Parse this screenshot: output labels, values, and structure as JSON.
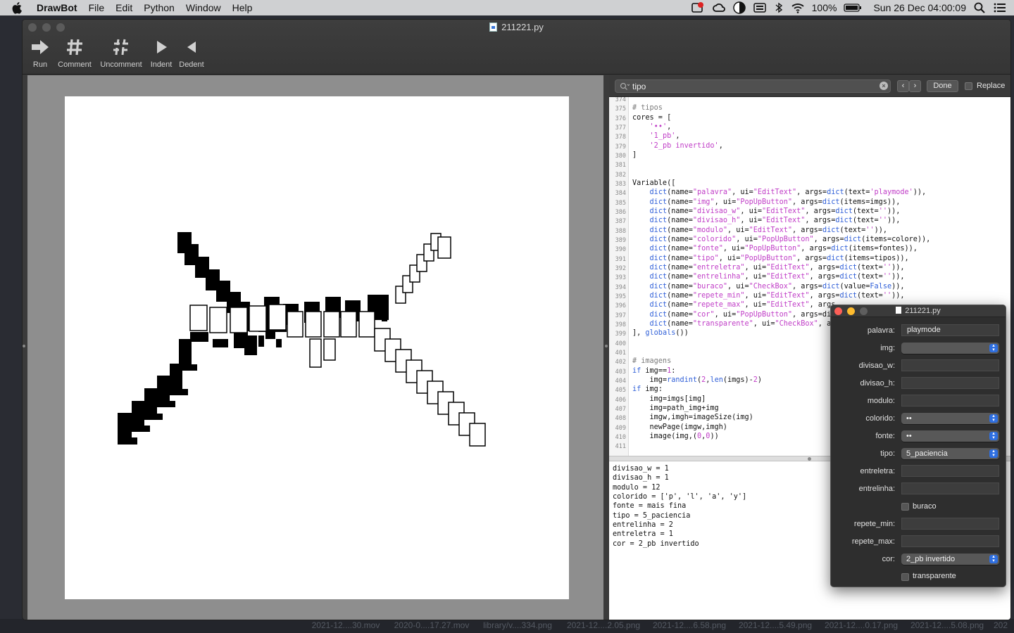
{
  "menubar": {
    "app_name": "DrawBot",
    "items": [
      "File",
      "Edit",
      "Python",
      "Window",
      "Help"
    ],
    "battery": "100%",
    "clock": "Sun 26 Dec  04:00:09"
  },
  "window": {
    "title": "211221.py",
    "toolbar": {
      "run": "Run",
      "comment": "Comment",
      "uncomment": "Uncomment",
      "indent": "Indent",
      "dedent": "Dedent"
    }
  },
  "findbar": {
    "query": "tipo",
    "done": "Done",
    "replace": "Replace"
  },
  "code": {
    "line_numbers": [
      "374",
      "375",
      "376",
      "377",
      "378",
      "379",
      "380",
      "381",
      "382",
      "383",
      "384",
      "385",
      "386",
      "387",
      "388",
      "389",
      "390",
      "391",
      "392",
      "393",
      "394",
      "395",
      "396",
      "397",
      "398",
      "399",
      "400",
      "401",
      "402",
      "403",
      "404",
      "405",
      "406",
      "407",
      "408",
      "409",
      "410",
      "411"
    ],
    "lines": [
      "",
      "# tipos",
      "cores = [",
      "    '••',",
      "    '1_pb',",
      "    '2_pb invertido',",
      "]",
      "",
      "",
      "Variable([",
      "    dict(name=\"palavra\", ui=\"EditText\", args=dict(text='playmode')),",
      "    dict(name=\"img\", ui=\"PopUpButton\", args=dict(items=imgs)),",
      "    dict(name=\"divisao_w\", ui=\"EditText\", args=dict(text='')),",
      "    dict(name=\"divisao_h\", ui=\"EditText\", args=dict(text='')),",
      "    dict(name=\"modulo\", ui=\"EditText\", args=dict(text='')),",
      "    dict(name=\"colorido\", ui=\"PopUpButton\", args=dict(items=colore)),",
      "    dict(name=\"fonte\", ui=\"PopUpButton\", args=dict(items=fontes)),",
      "    dict(name=\"tipo\", ui=\"PopUpButton\", args=dict(items=tipos)),",
      "    dict(name=\"entreletra\", ui=\"EditText\", args=dict(text='')),",
      "    dict(name=\"entrelinha\", ui=\"EditText\", args=dict(text='')),",
      "    dict(name=\"buraco\", ui=\"CheckBox\", args=dict(value=False)),",
      "    dict(name=\"repete_min\", ui=\"EditText\", args=dict(text='')),",
      "    dict(name=\"repete_max\", ui=\"EditText\", args",
      "    dict(name=\"cor\", ui=\"PopUpButton\", args=di",
      "    dict(name=\"transparente\", ui=\"CheckBox\", a",
      "], globals())",
      "",
      "",
      "# imagens",
      "if img==1:",
      "    img=randint(2,len(imgs)-2)",
      "if img:",
      "    img=imgs[img]",
      "    img=path_img+img",
      "    imgw,imgh=imageSize(img)",
      "    newPage(imgw,imgh)",
      "    image(img,(0,0))",
      ""
    ]
  },
  "output": [
    "divisao_w = 1",
    "divisao_h = 1",
    "modulo = 12",
    "colorido = ['p', 'l', 'a', 'y']",
    "fonte = mais fina",
    "tipo = 5_paciencia",
    "entrelinha = 2",
    "entreletra = 1",
    "cor = 2_pb invertido"
  ],
  "panel": {
    "title": "211221.py",
    "palavra_label": "palavra:",
    "palavra_value": "playmode",
    "img_label": "img:",
    "img_value": "",
    "divisao_w_label": "divisao_w:",
    "divisao_h_label": "divisao_h:",
    "modulo_label": "modulo:",
    "colorido_label": "colorido:",
    "colorido_value": "••",
    "fonte_label": "fonte:",
    "fonte_value": "••",
    "tipo_label": "tipo:",
    "tipo_value": "5_paciencia",
    "entreletra_label": "entreletra:",
    "entrelinha_label": "entrelinha:",
    "buraco_label": "buraco",
    "repete_min_label": "repete_min:",
    "repete_max_label": "repete_max:",
    "cor_label": "cor:",
    "cor_value": "2_pb invertido",
    "transparente_label": "transparente"
  },
  "desktop_files": [
    "2021-12....30.mov",
    "2020-0....17.27.mov",
    "library/v....334.png",
    "2021-12....2.05.png",
    "2021-12....6.58.png",
    "2021-12....5.49.png",
    "2021-12....0.17.png",
    "2021-12....5.08.png",
    "202"
  ]
}
